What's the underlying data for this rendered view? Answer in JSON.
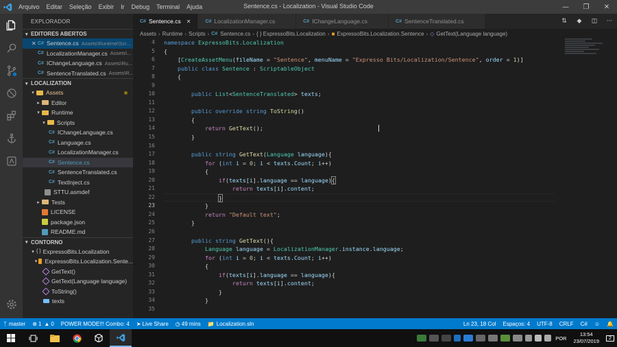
{
  "window": {
    "title": "Sentence.cs - Localization - Visual Studio Code",
    "menu": [
      "Arquivo",
      "Editar",
      "Seleção",
      "Exibir",
      "Ir",
      "Debug",
      "Terminal",
      "Ajuda"
    ]
  },
  "sidebar": {
    "title": "EXPLORADOR",
    "open_editors": {
      "header": "EDITORES ABERTOS",
      "items": [
        {
          "name": "Sentence.cs",
          "path": "Assets\\Runtime\\Scr..."
        },
        {
          "name": "LocalizationManager.cs",
          "path": "Assets\\..."
        },
        {
          "name": "IChangeLanguage.cs",
          "path": "Assets\\Ru..."
        },
        {
          "name": "SentenceTranslated.cs",
          "path": "Assets\\R..."
        }
      ]
    },
    "workspace": {
      "header": "LOCALIZATION",
      "tree": [
        {
          "label": "Assets"
        },
        {
          "label": "Editor"
        },
        {
          "label": "Runtime"
        },
        {
          "label": "Scripts"
        },
        {
          "label": "IChangeLanguage.cs"
        },
        {
          "label": "Language.cs"
        },
        {
          "label": "LocalizationManager.cs"
        },
        {
          "label": "Sentence.cs"
        },
        {
          "label": "SentenceTranslated.cs"
        },
        {
          "label": "TextInject.cs"
        },
        {
          "label": "STTU.asmdef"
        },
        {
          "label": "Tests"
        },
        {
          "label": "LICENSE"
        },
        {
          "label": "package.json"
        },
        {
          "label": "README.md"
        }
      ]
    },
    "outline": {
      "header": "CONTORNO",
      "items": [
        {
          "label": "ExpressoBits.Localization"
        },
        {
          "label": "ExpressoBits.Localization.Sente..."
        },
        {
          "label": "GetText()"
        },
        {
          "label": "GetText(Language language)"
        },
        {
          "label": "ToString()"
        },
        {
          "label": "texts"
        }
      ]
    }
  },
  "tabs": [
    {
      "label": "Sentence.cs",
      "active": true
    },
    {
      "label": "LocalizationManager.cs"
    },
    {
      "label": "IChangeLanguage.cs"
    },
    {
      "label": "SentenceTranslated.cs"
    }
  ],
  "breadcrumbs": [
    "Assets",
    "Runtime",
    "Scripts",
    "Sentence.cs",
    "{ } ExpressoBits.Localization",
    "ExpressoBits.Localization.Sentence",
    "GetText(Language language)"
  ],
  "editor": {
    "line_numbers": [
      "4",
      "5",
      "6",
      "7",
      "8",
      "9",
      "10",
      "11",
      "12",
      "13",
      "14",
      "15",
      "16",
      "17",
      "18",
      "19",
      "20",
      "21",
      "22",
      "23",
      "24",
      "25",
      "26",
      "27",
      "28",
      "29",
      "30",
      "31",
      "32",
      "33",
      "34",
      "35"
    ],
    "current_line": "23"
  },
  "status": {
    "branch": "master",
    "errors": "1",
    "warnings": "0",
    "power_mode": "POWER MODE!!! Combo: 4",
    "live_share": "Live Share",
    "time_spent": "49 mins",
    "solution": "Localization.sln",
    "position": "Ln 23, 18 Col",
    "spaces": "Espaços: 4",
    "encoding": "UTF-8",
    "eol": "CRLF",
    "language": "C#"
  },
  "taskbar": {
    "lang": "POR",
    "time": "13:54",
    "date": "23/07/2019",
    "notifications": "2"
  }
}
